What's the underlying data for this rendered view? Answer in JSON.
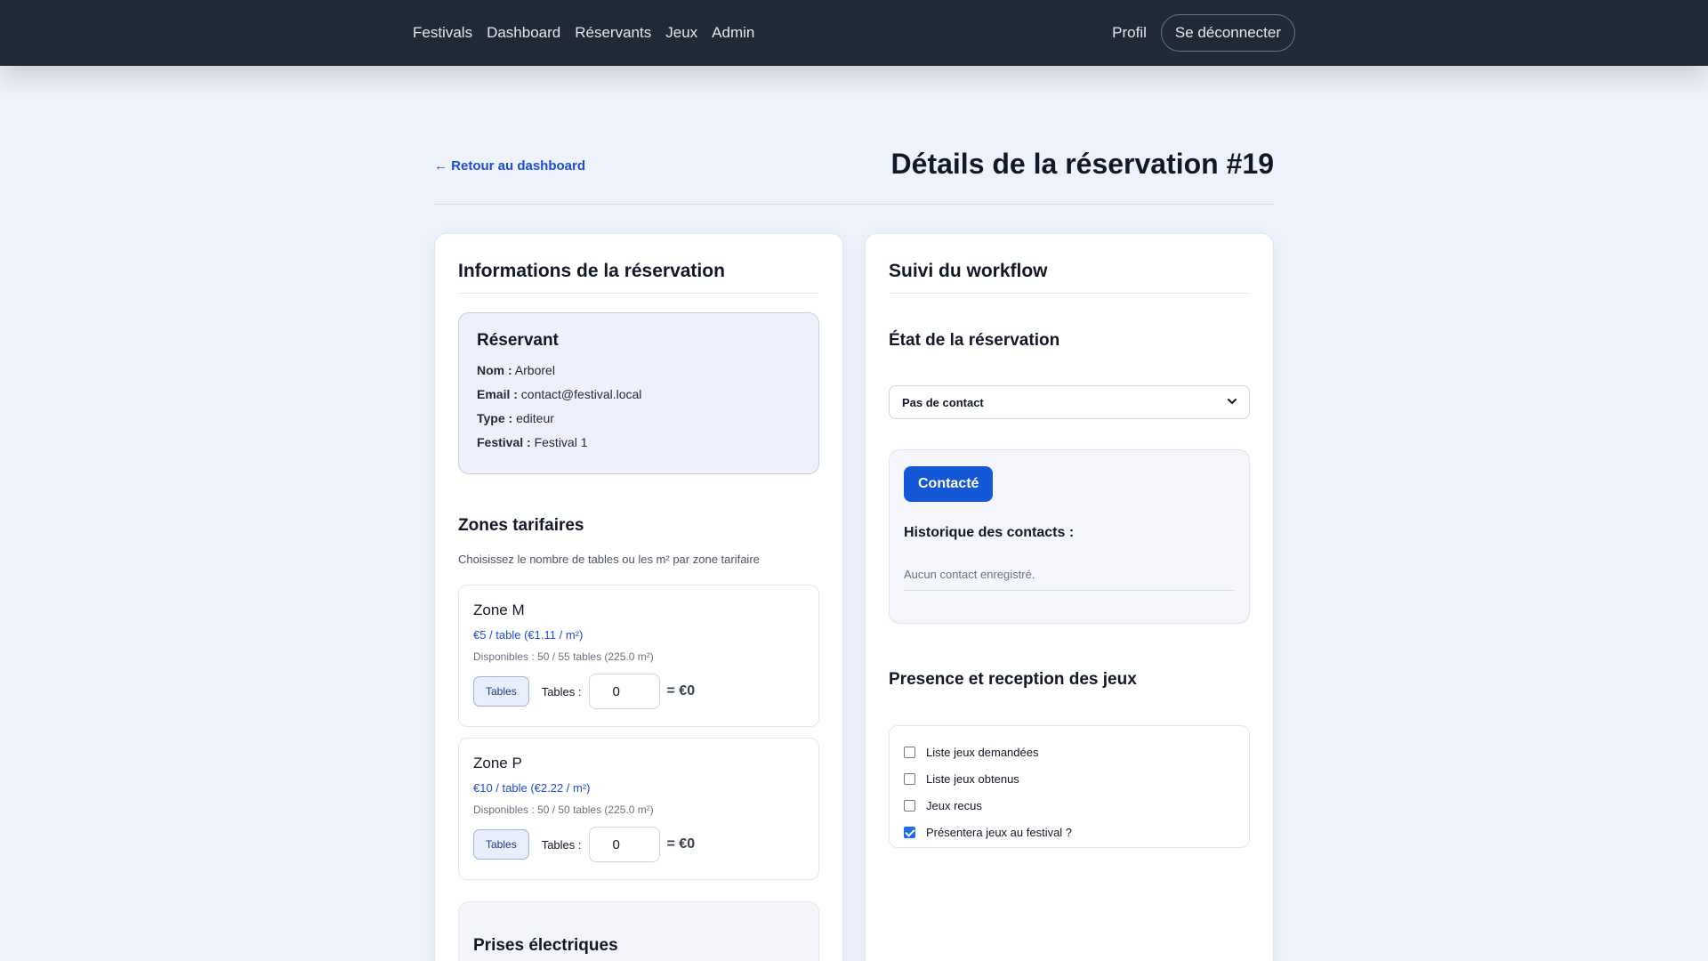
{
  "nav": {
    "left": [
      "Festivals",
      "Dashboard",
      "Réservants",
      "Jeux",
      "Admin"
    ],
    "profile": "Profil",
    "logout": "Se déconnecter"
  },
  "page": {
    "back_link": "← Retour au dashboard",
    "title": "Détails de la réservation #19"
  },
  "info_card": {
    "title": "Informations de la réservation",
    "reservant": {
      "heading": "Réservant",
      "nom_label": "Nom :",
      "nom": "Arborel",
      "email_label": "Email :",
      "email": "contact@festival.local",
      "type_label": "Type :",
      "type": "editeur",
      "festival_label": "Festival :",
      "festival": "Festival 1"
    },
    "zones_heading": "Zones tarifaires",
    "zones_sub": "Choisissez le nombre de tables ou les m² par zone tarifaire",
    "zones": [
      {
        "name": "Zone M",
        "price": "€5 / table (€1.11 / m²)",
        "avail": "Disponibles : 50 / 55 tables (225.0 m²)",
        "mode": "Tables",
        "label": "Tables :",
        "qty": "0",
        "total": "= €0"
      },
      {
        "name": "Zone P",
        "price": "€10 / table (€2.22 / m²)",
        "avail": "Disponibles : 50 / 50 tables (225.0 m²)",
        "mode": "Tables",
        "label": "Tables :",
        "qty": "0",
        "total": "= €0"
      }
    ],
    "prises_heading": "Prises électriques"
  },
  "workflow_card": {
    "title": "Suivi du workflow",
    "state_heading": "État de la réservation",
    "state_value": "Pas de contact",
    "contact_button": "Contacté",
    "history_heading": "Historique des contacts :",
    "history_empty": "Aucun contact enregistré.",
    "presence_heading": "Presence et reception des jeux",
    "checks": [
      {
        "label": "Liste jeux demandées",
        "checked": false
      },
      {
        "label": "Liste jeux obtenus",
        "checked": false
      },
      {
        "label": "Jeux recus",
        "checked": false
      },
      {
        "label": "Présentera jeux au festival ?",
        "checked": true
      }
    ]
  },
  "colors": {
    "navbar": "#1f2937",
    "accent": "#1558d6",
    "link": "#1d4ed8",
    "background": "#eef2fa"
  }
}
